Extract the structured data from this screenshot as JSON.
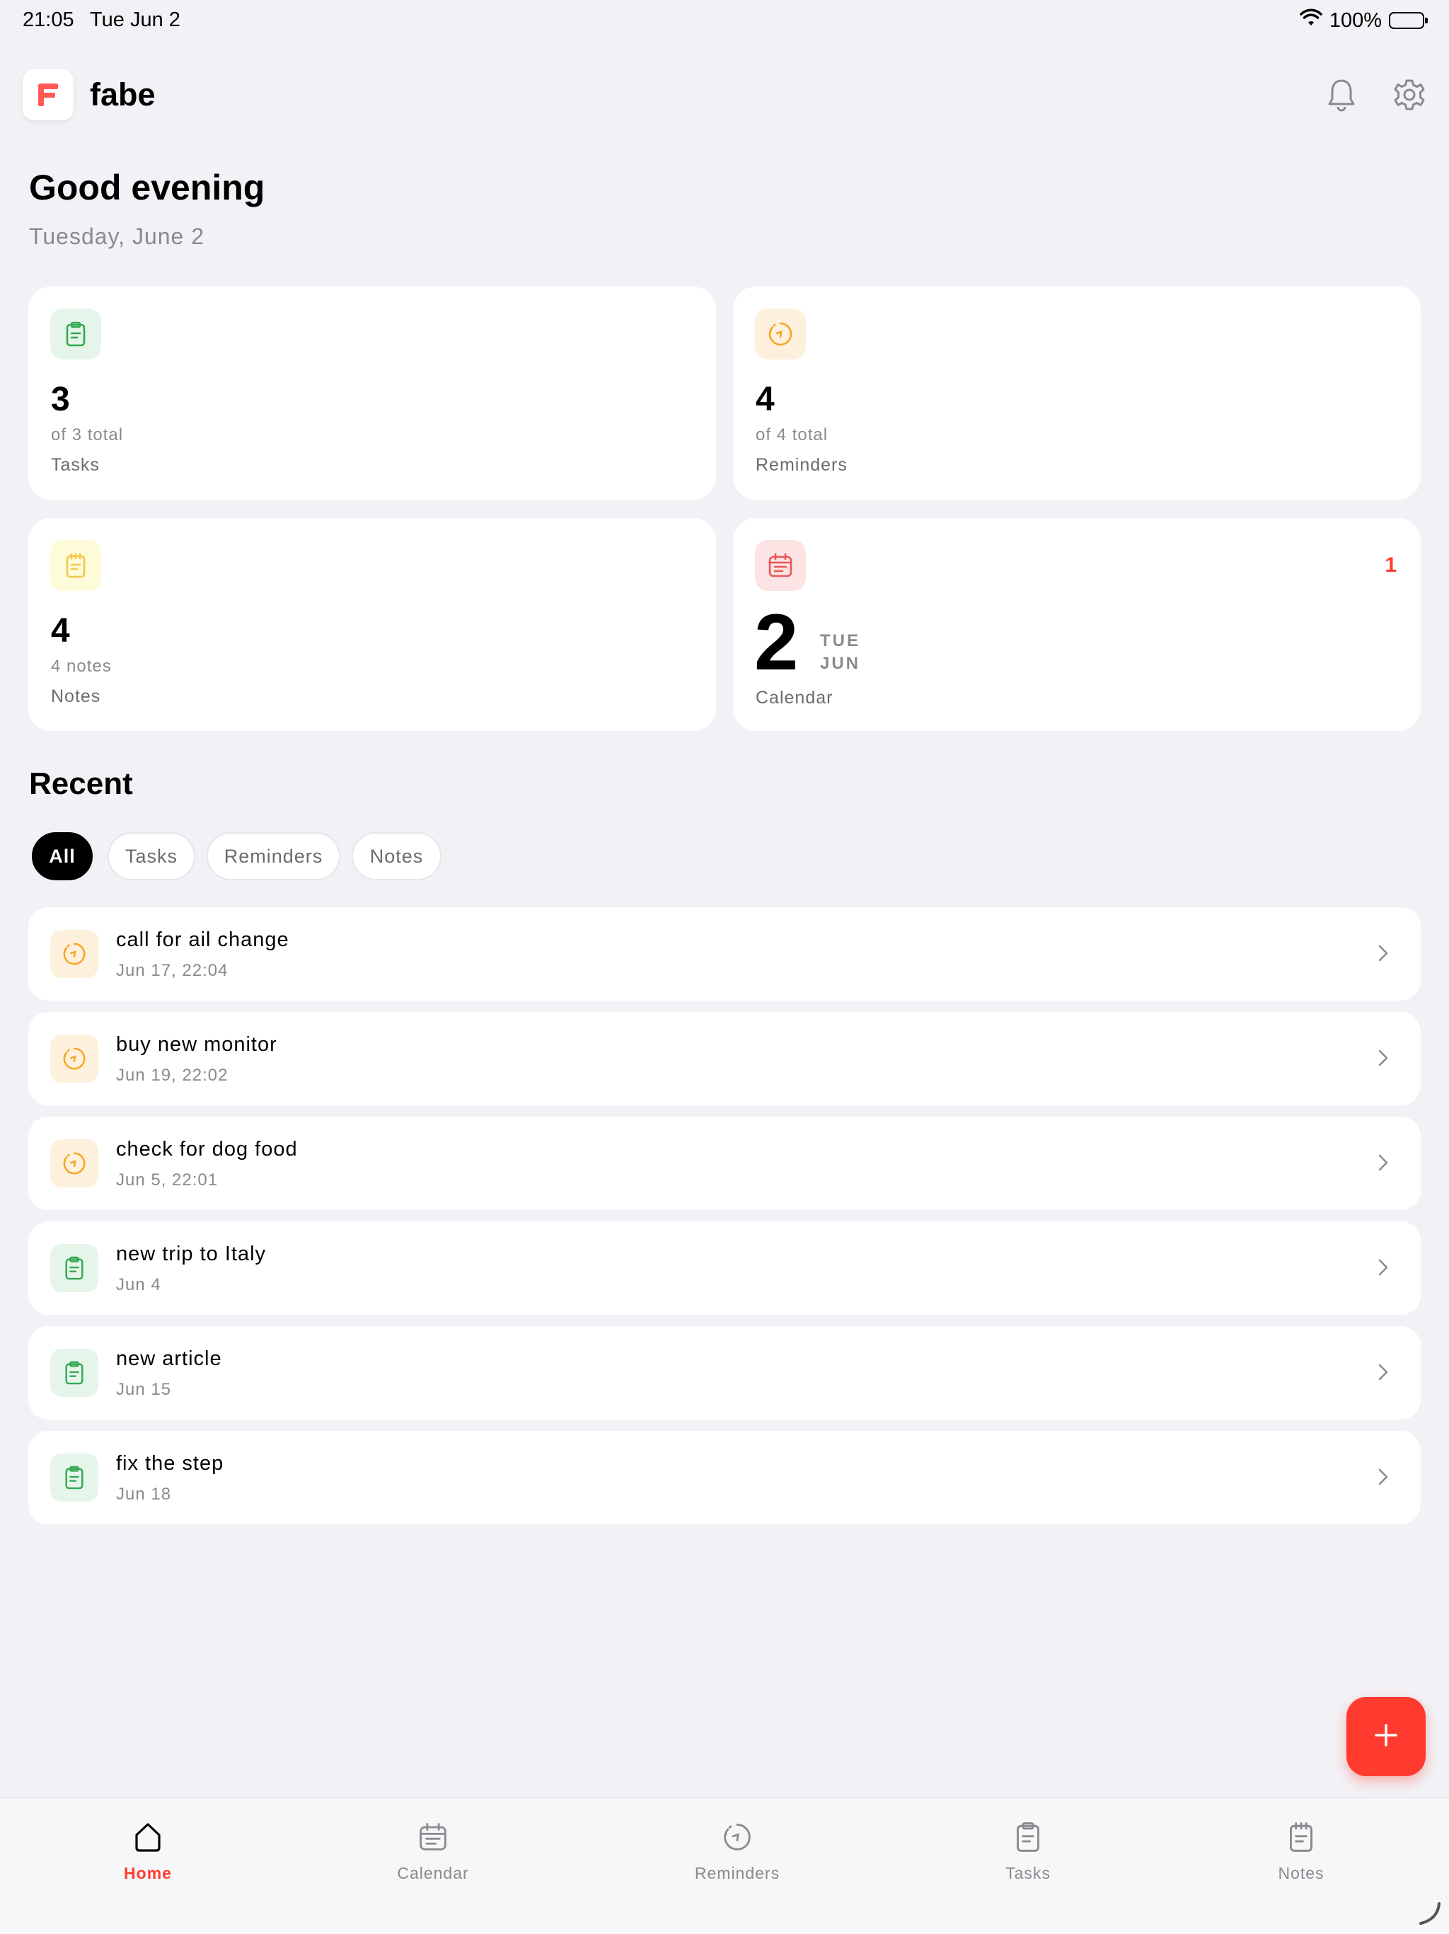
{
  "status_bar": {
    "time": "21:05",
    "date": "Tue Jun 2",
    "battery": "100%"
  },
  "header": {
    "app_name": "fabe",
    "logo_letter": "F"
  },
  "greeting": {
    "title": "Good evening",
    "date": "Tuesday, June 2"
  },
  "stats": {
    "tasks": {
      "count": "3",
      "sub": "of 3 total",
      "label": "Tasks",
      "icon": "clipboard-icon",
      "color": "#34a853"
    },
    "reminders": {
      "count": "4",
      "sub": "of 4 total",
      "label": "Reminders",
      "icon": "clock-icon",
      "color": "#f5a623"
    },
    "notes": {
      "count": "4",
      "sub": "4 notes",
      "label": "Notes",
      "icon": "note-icon",
      "color": "#f2c94c"
    },
    "calendar": {
      "day": "2",
      "dow": "TUE",
      "month": "JUN",
      "label": "Calendar",
      "badge": "1",
      "icon": "calendar-icon",
      "color": "#eb5757"
    }
  },
  "recent": {
    "title": "Recent",
    "filters": [
      "All",
      "Tasks",
      "Reminders",
      "Notes"
    ],
    "active_filter": "All",
    "items": [
      {
        "title": "call for ail change",
        "date": "Jun 17, 22:04",
        "type": "reminder"
      },
      {
        "title": "buy new monitor",
        "date": "Jun 19, 22:02",
        "type": "reminder"
      },
      {
        "title": "check for dog food",
        "date": "Jun 5, 22:01",
        "type": "reminder"
      },
      {
        "title": "new trip to Italy",
        "date": "Jun 4",
        "type": "task"
      },
      {
        "title": "new article",
        "date": "Jun 15",
        "type": "task"
      },
      {
        "title": "fix the step",
        "date": "Jun 18",
        "type": "task"
      }
    ]
  },
  "fab": {
    "icon": "plus-icon"
  },
  "tabbar": {
    "items": [
      {
        "label": "Home",
        "icon": "home-icon",
        "active": true
      },
      {
        "label": "Calendar",
        "icon": "calendar-icon",
        "active": false
      },
      {
        "label": "Reminders",
        "icon": "clock-icon",
        "active": false
      },
      {
        "label": "Tasks",
        "icon": "clipboard-icon",
        "active": false
      },
      {
        "label": "Notes",
        "icon": "note-icon",
        "active": false
      }
    ]
  },
  "colors": {
    "accent": "#ff3b30",
    "background": "#f2f2f6"
  }
}
